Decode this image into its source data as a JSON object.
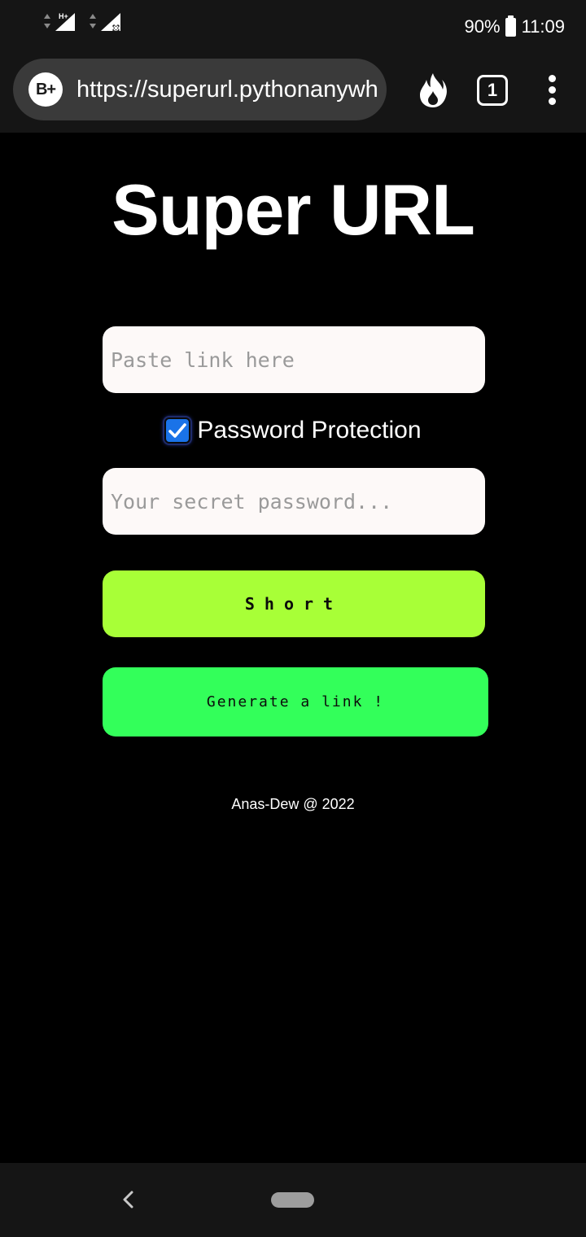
{
  "status_bar": {
    "battery": "90%",
    "time": "11:09",
    "network_label": "H+"
  },
  "browser": {
    "site_badge": "B+",
    "url": "https://superurl.pythonanywhere.com",
    "tab_count": "1"
  },
  "page": {
    "title": "Super URL",
    "link_input": {
      "value": "",
      "placeholder": "Paste link here"
    },
    "password_protection": {
      "label": "Password Protection",
      "checked": true
    },
    "password_input": {
      "value": "",
      "placeholder": "Your secret password..."
    },
    "short_button": "Short",
    "generate_button": "Generate a link !",
    "footer": "Anas-Dew @ 2022"
  },
  "colors": {
    "short_button_bg": "#a8ff37",
    "generate_button_bg": "#33ff5a",
    "checkbox_accent": "#1a73e8"
  }
}
